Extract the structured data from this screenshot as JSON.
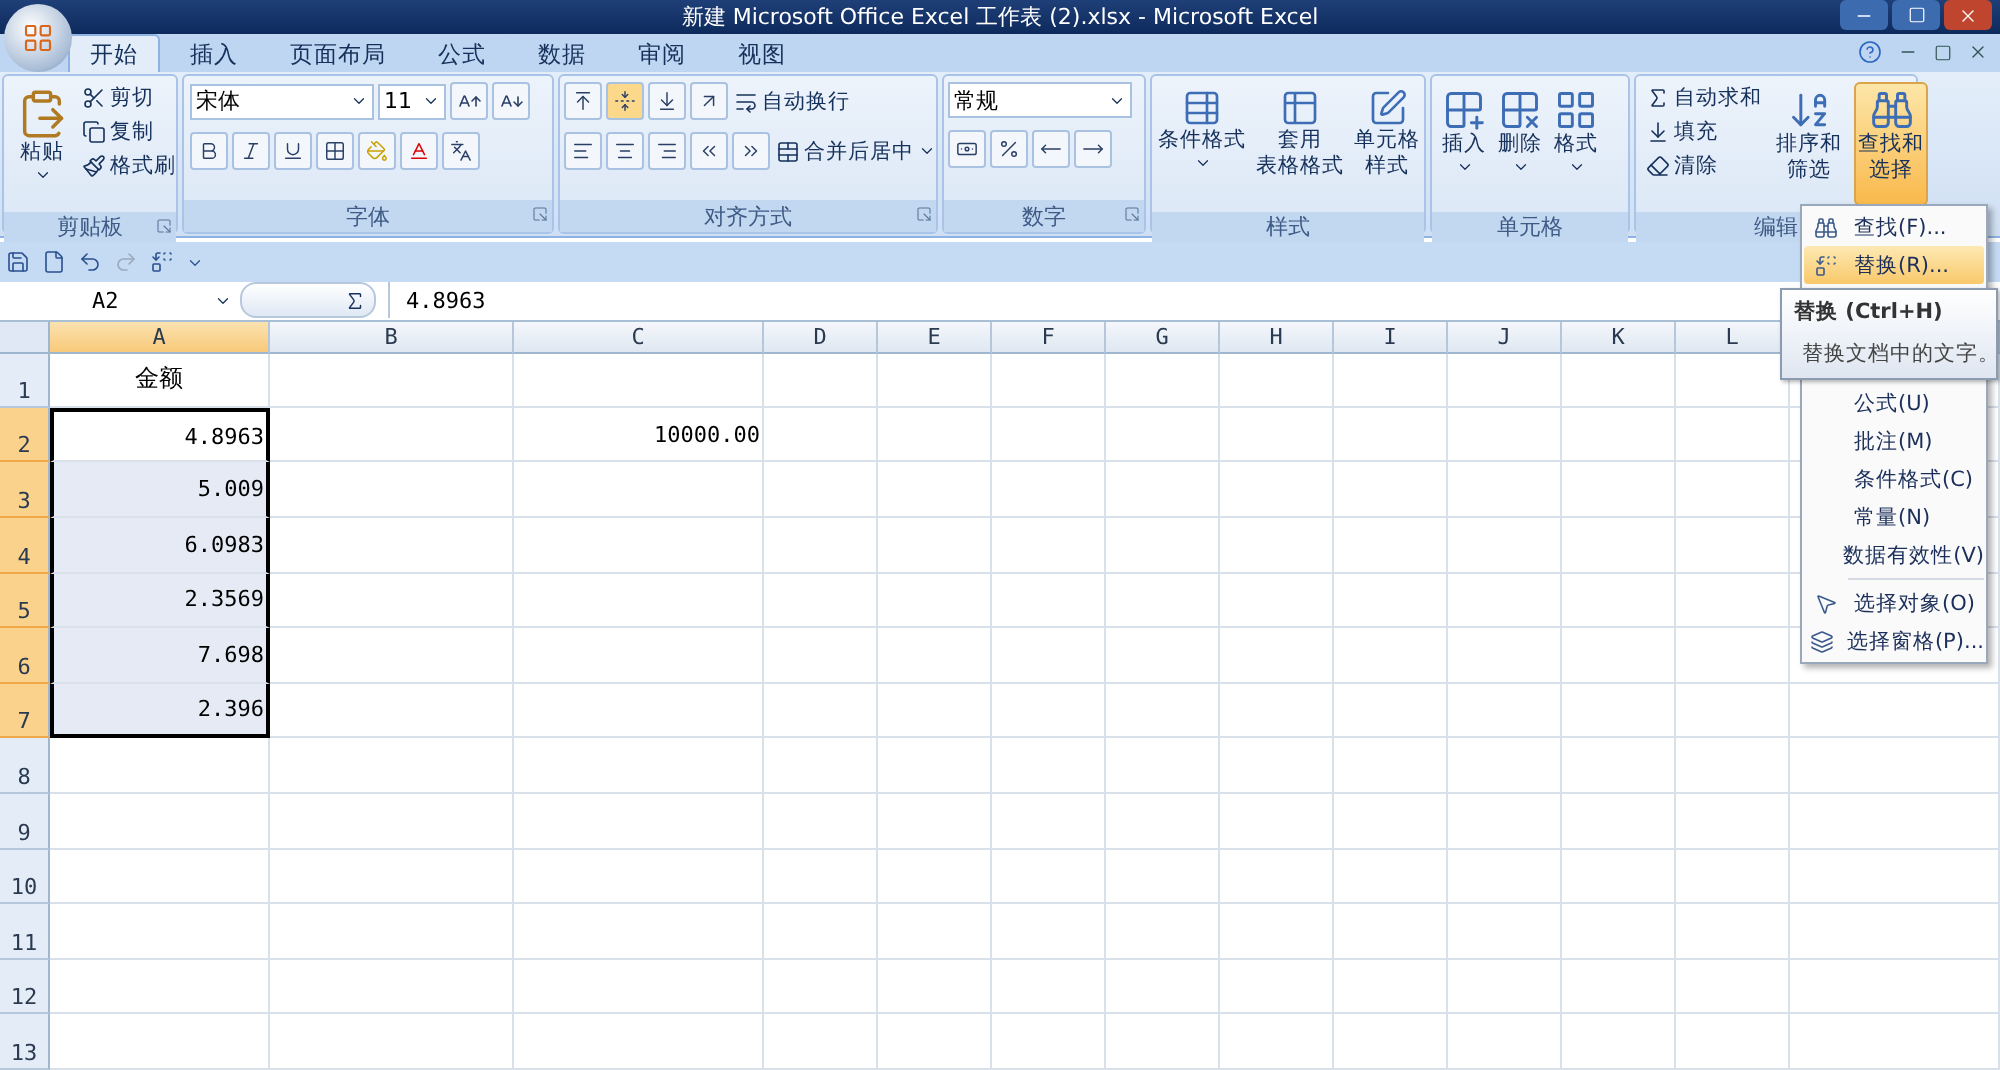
{
  "window": {
    "title": "新建 Microsoft Office Excel 工作表 (2).xlsx - Microsoft Excel"
  },
  "tabs": [
    {
      "label": "开始",
      "selected": true
    },
    {
      "label": "插入",
      "selected": false
    },
    {
      "label": "页面布局",
      "selected": false
    },
    {
      "label": "公式",
      "selected": false
    },
    {
      "label": "数据",
      "selected": false
    },
    {
      "label": "审阅",
      "selected": false
    },
    {
      "label": "视图",
      "selected": false
    }
  ],
  "ribbon": {
    "clipboard": {
      "label": "剪贴板",
      "paste": "粘贴",
      "actions": [
        "剪切",
        "复制",
        "格式刷"
      ]
    },
    "font": {
      "label": "字体",
      "font_name": "宋体",
      "font_size": "11"
    },
    "alignment": {
      "label": "对齐方式",
      "wrap": "自动换行",
      "merge": "合并后居中"
    },
    "number": {
      "label": "数字",
      "format": "常规"
    },
    "styles": {
      "label": "样式",
      "buttons": [
        [
          "条件格式"
        ],
        [
          "套用",
          "表格格式"
        ],
        [
          "单元格",
          "样式"
        ]
      ]
    },
    "cells": {
      "label": "单元格",
      "buttons": [
        [
          "插入"
        ],
        [
          "删除"
        ],
        [
          "格式"
        ]
      ]
    },
    "editing": {
      "label": "编辑",
      "actions": [
        "自动求和",
        "填充",
        "清除"
      ],
      "buttons": [
        {
          "lines": [
            "排序和",
            "筛选"
          ],
          "selected": false
        },
        {
          "lines": [
            "查找和",
            "选择"
          ],
          "selected": true
        }
      ]
    }
  },
  "formula_bar": {
    "name_box": "A2",
    "value": "4.8963"
  },
  "columns": [
    {
      "label": "A",
      "selected": true
    },
    {
      "label": "B",
      "selected": false
    },
    {
      "label": "C",
      "selected": false
    },
    {
      "label": "D",
      "selected": false
    },
    {
      "label": "E",
      "selected": false
    },
    {
      "label": "F",
      "selected": false
    },
    {
      "label": "G",
      "selected": false
    },
    {
      "label": "H",
      "selected": false
    },
    {
      "label": "I",
      "selected": false
    },
    {
      "label": "J",
      "selected": false
    },
    {
      "label": "K",
      "selected": false
    },
    {
      "label": "L",
      "selected": false
    }
  ],
  "rows": [
    {
      "label": "1",
      "kind": "header",
      "selected": false,
      "column_1": "金额"
    },
    {
      "label": "2",
      "kind": "data",
      "selected": true,
      "column_1": "4.8963",
      "column_3": "10000.00"
    },
    {
      "label": "3",
      "kind": "data",
      "selected": true,
      "column_1": "5.009"
    },
    {
      "label": "4",
      "kind": "data",
      "selected": true,
      "column_1": "6.0983"
    },
    {
      "label": "5",
      "kind": "data",
      "selected": true,
      "column_1": "2.3569"
    },
    {
      "label": "6",
      "kind": "data",
      "selected": true,
      "column_1": "7.698"
    },
    {
      "label": "7",
      "kind": "data",
      "selected": true,
      "column_1": "2.396"
    },
    {
      "label": "8",
      "kind": "data",
      "selected": false
    },
    {
      "label": "9",
      "kind": "data",
      "selected": false
    },
    {
      "label": "10",
      "kind": "data",
      "selected": false
    },
    {
      "label": "11",
      "kind": "data",
      "selected": false
    },
    {
      "label": "12",
      "kind": "data",
      "selected": false
    },
    {
      "label": "13",
      "kind": "data",
      "selected": false
    }
  ],
  "find_menu": {
    "items": [
      {
        "kind": "find",
        "label": "查找(F)...",
        "selected": false
      },
      {
        "kind": "replace",
        "label": "替换(R)...",
        "selected": true
      },
      {
        "kind": "plain",
        "label": "公式(U)",
        "selected": false
      },
      {
        "kind": "plain",
        "label": "批注(M)",
        "selected": false
      },
      {
        "kind": "plain",
        "label": "条件格式(C)",
        "selected": false
      },
      {
        "kind": "plain",
        "label": "常量(N)",
        "selected": false
      },
      {
        "kind": "plain",
        "label": "数据有效性(V)",
        "selected": false
      },
      {
        "kind": "separator"
      },
      {
        "kind": "select",
        "label": "选择对象(O)",
        "selected": false
      },
      {
        "kind": "pane",
        "label": "选择窗格(P)...",
        "selected": false
      }
    ],
    "tooltip": {
      "title": "替换 (Ctrl+H)",
      "text": "替换文档中的文字。"
    }
  }
}
